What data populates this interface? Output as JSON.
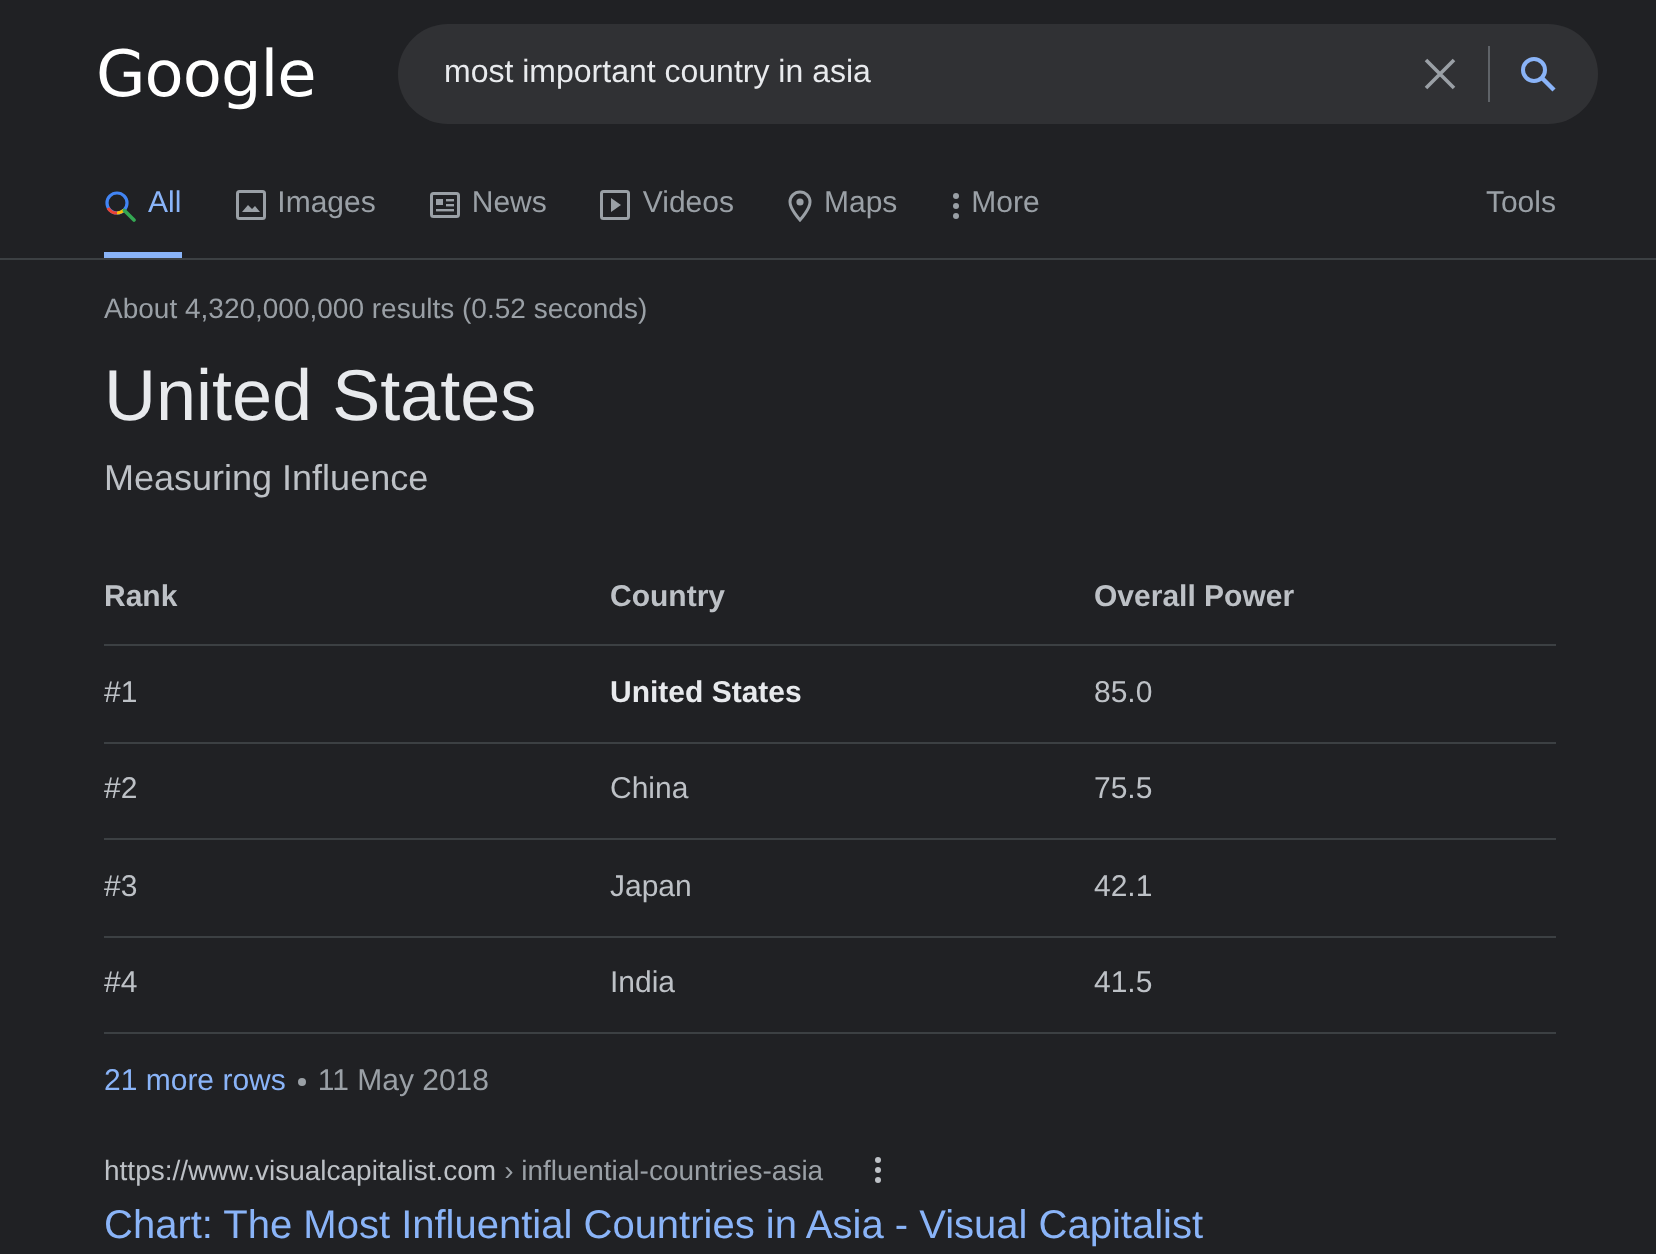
{
  "header": {
    "logo": "Google",
    "search": {
      "value": "most important country in asia"
    }
  },
  "tabs": [
    {
      "label": "All",
      "kind": "all",
      "selected": true
    },
    {
      "label": "Images",
      "kind": "images",
      "selected": false
    },
    {
      "label": "News",
      "kind": "news",
      "selected": false
    },
    {
      "label": "Videos",
      "kind": "videos",
      "selected": false
    },
    {
      "label": "Maps",
      "kind": "maps",
      "selected": false
    },
    {
      "label": "More",
      "kind": "more",
      "selected": false
    }
  ],
  "tools": "Tools",
  "result_stats": "About 4,320,000,000 results (0.52 seconds)",
  "answer": {
    "title": "United States",
    "subtitle": "Measuring Influence"
  },
  "table": {
    "columns": [
      "Rank",
      "Country",
      "Overall Power"
    ],
    "rows": [
      {
        "rank": "#1",
        "country": "United States",
        "power": "85.0",
        "highlighted": true
      },
      {
        "rank": "#2",
        "country": "China",
        "power": "75.5",
        "highlighted": false
      },
      {
        "rank": "#3",
        "country": "Japan",
        "power": "42.1",
        "highlighted": false
      },
      {
        "rank": "#4",
        "country": "India",
        "power": "41.5",
        "highlighted": false
      }
    ]
  },
  "more_rows": {
    "link": "21 more rows",
    "date": "11 May 2018"
  },
  "result": {
    "url": "https://www.visualcapitalist.com",
    "path": "› influential-countries-asia",
    "title": "Chart: The Most Influential Countries in Asia - Visual Capitalist"
  }
}
